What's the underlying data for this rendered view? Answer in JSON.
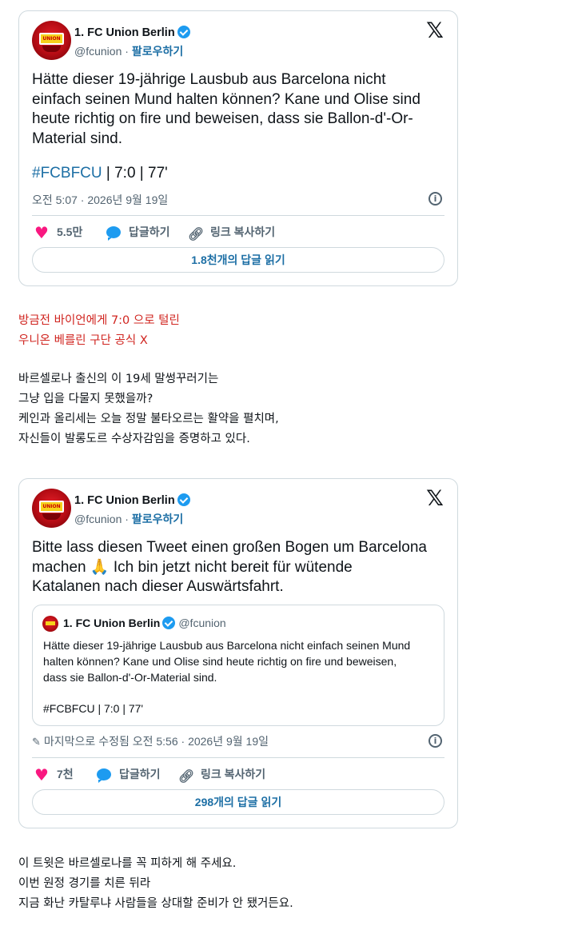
{
  "tweet1": {
    "display_name": "1. FC Union Berlin",
    "handle": "@fcunion",
    "separator": " · ",
    "follow_label": "팔로우하기",
    "text": "Hätte dieser 19-jährige Lausbub aus Barcelona nicht\neinfach seinen Mund halten können? Kane und Olise sind\nheute richtig on fire und beweisen, dass sie Ballon-d'-Or-\nMaterial sind.",
    "hashtag": "#FCBFCU",
    "hashtag_rest": " | 7:0 | 77'",
    "timestamp": "오전 5:07 · 2026년 9월 19일",
    "likes": "5.5만",
    "reply_label": "답글하기",
    "copy_link_label": "링크 복사하기",
    "read_replies": "1.8천개의 답글 읽기"
  },
  "caption1": {
    "line1": "방금전 바이언에게 7:0 으로 털린",
    "line2": "우니온 베를린 구단 공식 X"
  },
  "translation1": {
    "line1": "바르셀로나 출신의 이 19세 말썽꾸러기는",
    "line2": "그냥 입을 다물지 못했을까?",
    "line3": "케인과 올리세는 오늘 정말 불타오르는 활약을 펼치며,",
    "line4": "자신들이 발롱도르 수상자감임을 증명하고 있다."
  },
  "tweet2": {
    "display_name": "1. FC Union Berlin",
    "handle": "@fcunion",
    "separator": " · ",
    "follow_label": "팔로우하기",
    "text_part1": "Bitte lass diesen Tweet einen großen Bogen um Barcelona\nmachen ",
    "emoji": "🙏",
    "text_part2": " Ich bin jetzt nicht bereit für wütende\nKatalanen nach dieser Auswärtsfahrt.",
    "quote": {
      "display_name": "1. FC Union Berlin",
      "handle": "@fcunion",
      "text": "Hätte dieser 19-jährige Lausbub aus Barcelona nicht einfach seinen Mund\nhalten können? Kane und Olise sind heute richtig on fire und beweisen,\ndass sie Ballon-d'-Or-Material sind.",
      "hashtag_line": "#FCBFCU | 7:0 | 77'"
    },
    "timestamp": "마지막으로 수정됨 오전 5:56 · 2026년 9월 19일",
    "likes": "7천",
    "reply_label": "답글하기",
    "copy_link_label": "링크 복사하기",
    "read_replies": "298개의 답글 읽기"
  },
  "translation2": {
    "line1": "이 트윗은 바르셀로나를 꼭 피하게 해 주세요.",
    "line2": "이번 원정 경기를 치른 뒤라",
    "line3": "지금 화난 카탈루냐 사람들을 상대할 준비가 안 됐거든요."
  },
  "icons": {
    "x_logo": "x-logo-icon",
    "verified": "verified-badge-icon",
    "heart": "heart-icon",
    "reply": "reply-bubble-icon",
    "link": "link-icon",
    "info": "info-icon",
    "pencil": "pencil-icon"
  },
  "colors": {
    "link_blue": "#1d6fa5",
    "verified_blue": "#1d9bf0",
    "heart_pink": "#f91880",
    "caption_red": "#d0241f",
    "border": "#cfd9de",
    "muted": "#536471"
  }
}
